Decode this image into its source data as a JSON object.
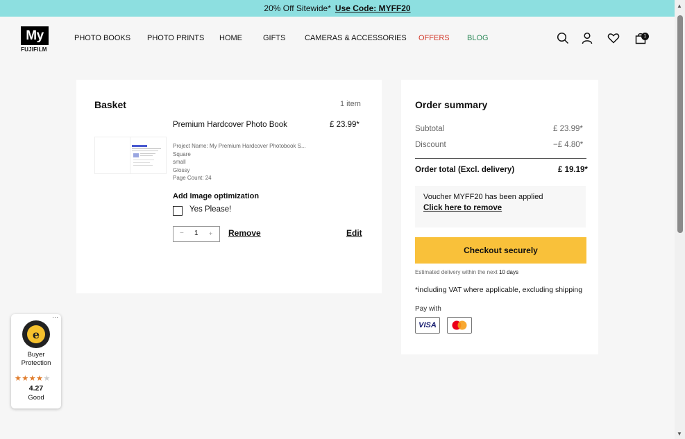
{
  "promo": {
    "text": "20% Off Sitewide*",
    "code": "Use Code: MYFF20"
  },
  "header": {
    "logo_top": "My",
    "logo_brand": "FUJIFILM",
    "nav": [
      "PHOTO BOOKS",
      "PHOTO PRINTS",
      "HOME",
      "GIFTS",
      "CAMERAS & ACCESSORIES",
      "OFFERS",
      "BLOG"
    ],
    "cart_count": "1"
  },
  "basket": {
    "title": "Basket",
    "item_count": "1 item",
    "product": {
      "name": "Premium Hardcover Photo Book",
      "price": "£ 23.99*",
      "properties": [
        "Project Name: My Premium Hardcover Photobook S...",
        "Square",
        "small",
        "Glossy",
        "Page Count:  24"
      ],
      "optimization_title": "Add Image optimization",
      "optimization_option": "Yes Please!",
      "quantity": "1",
      "minus": "−",
      "plus": "+",
      "remove_label": "Remove",
      "edit_label": "Edit"
    }
  },
  "summary": {
    "title": "Order summary",
    "subtotal_label": "Subtotal",
    "subtotal_value": "£ 23.99*",
    "discount_label": "Discount",
    "discount_value": "−£ 4.80*",
    "total_label": "Order total (Excl. delivery)",
    "total_value": "£ 19.19*",
    "voucher_text": "Voucher MYFF20 has been applied",
    "voucher_remove": "Click here to remove",
    "checkout_label": "Checkout securely",
    "delivery_prefix": "Estimated delivery within the next",
    "delivery_days": "10 days",
    "vat_note": "*including VAT where applicable, excluding shipping",
    "pay_with": "Pay with",
    "visa_label": "VISA"
  },
  "trust_badge": {
    "seal_letter": "e",
    "line1": "Buyer",
    "line2": "Protection",
    "rating": "4.27",
    "rating_label": "Good",
    "stars_filled": 4.27,
    "more": "···"
  },
  "colors": {
    "promo_bg": "#8ddfe0",
    "offers": "#d33a2c",
    "blog": "#2f8a5b",
    "checkout": "#f9c13a",
    "star": "#e07b2a"
  }
}
